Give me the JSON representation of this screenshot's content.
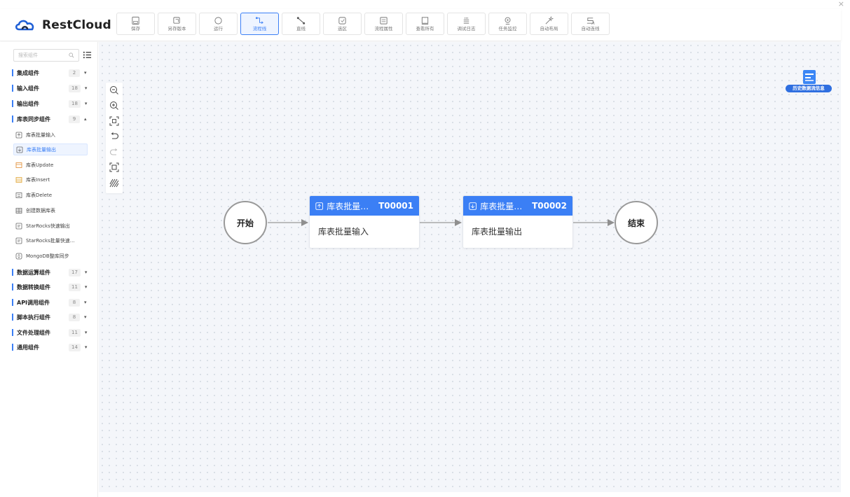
{
  "app": {
    "brand": "RestCloud"
  },
  "toolbar": [
    {
      "id": "save",
      "label": "保存",
      "icon": "save-icon"
    },
    {
      "id": "save-version",
      "label": "另存版本",
      "icon": "copy-icon"
    },
    {
      "id": "run",
      "label": "运行",
      "icon": "run-icon"
    },
    {
      "id": "flowline",
      "label": "流程线",
      "icon": "flowline-icon",
      "active": true
    },
    {
      "id": "straight",
      "label": "直线",
      "icon": "straight-line-icon"
    },
    {
      "id": "select",
      "label": "选区",
      "icon": "select-area-icon"
    },
    {
      "id": "props",
      "label": "流程属性",
      "icon": "properties-icon"
    },
    {
      "id": "view-all",
      "label": "查看所有",
      "icon": "view-all-icon"
    },
    {
      "id": "debug-log",
      "label": "调试日志",
      "icon": "log-icon"
    },
    {
      "id": "monitor",
      "label": "任务监控",
      "icon": "monitor-icon"
    },
    {
      "id": "auto-layout",
      "label": "自动布局",
      "icon": "magic-wand-icon"
    },
    {
      "id": "auto-connect",
      "label": "自动连线",
      "icon": "auto-connect-icon"
    }
  ],
  "sidebar": {
    "search_placeholder": "搜索组件",
    "groups": [
      {
        "name": "集成组件",
        "count": "2",
        "expanded": false
      },
      {
        "name": "输入组件",
        "count": "18",
        "expanded": false
      },
      {
        "name": "输出组件",
        "count": "18",
        "expanded": false
      },
      {
        "name": "库表同步组件",
        "count": "9",
        "expanded": true
      },
      {
        "name": "数据运算组件",
        "count": "17",
        "expanded": false
      },
      {
        "name": "数据转换组件",
        "count": "11",
        "expanded": false
      },
      {
        "name": "API调用组件",
        "count": "8",
        "expanded": false
      },
      {
        "name": "脚本执行组件",
        "count": "8",
        "expanded": false
      },
      {
        "name": "文件处理组件",
        "count": "11",
        "expanded": false
      },
      {
        "name": "通用组件",
        "count": "14",
        "expanded": false
      }
    ],
    "sync_items": [
      {
        "name": "库表批量输入",
        "selected": false
      },
      {
        "name": "库表批量输出",
        "selected": true
      },
      {
        "name": "库表Update",
        "selected": false
      },
      {
        "name": "库表Insert",
        "selected": false
      },
      {
        "name": "库表Delete",
        "selected": false
      },
      {
        "name": "创建数据库表",
        "selected": false
      },
      {
        "name": "StarRocks快速输出",
        "selected": false
      },
      {
        "name": "StarRocks批量快速…",
        "selected": false
      },
      {
        "name": "MongoDB整库同步",
        "selected": false
      }
    ]
  },
  "canvas": {
    "history_label": "历史数据流信息",
    "start_label": "开始",
    "end_label": "结束",
    "nodes": [
      {
        "title": "库表批量…",
        "id": "T00001",
        "body": "库表批量输入"
      },
      {
        "title": "库表批量…",
        "id": "T00002",
        "body": "库表批量输出"
      }
    ]
  }
}
